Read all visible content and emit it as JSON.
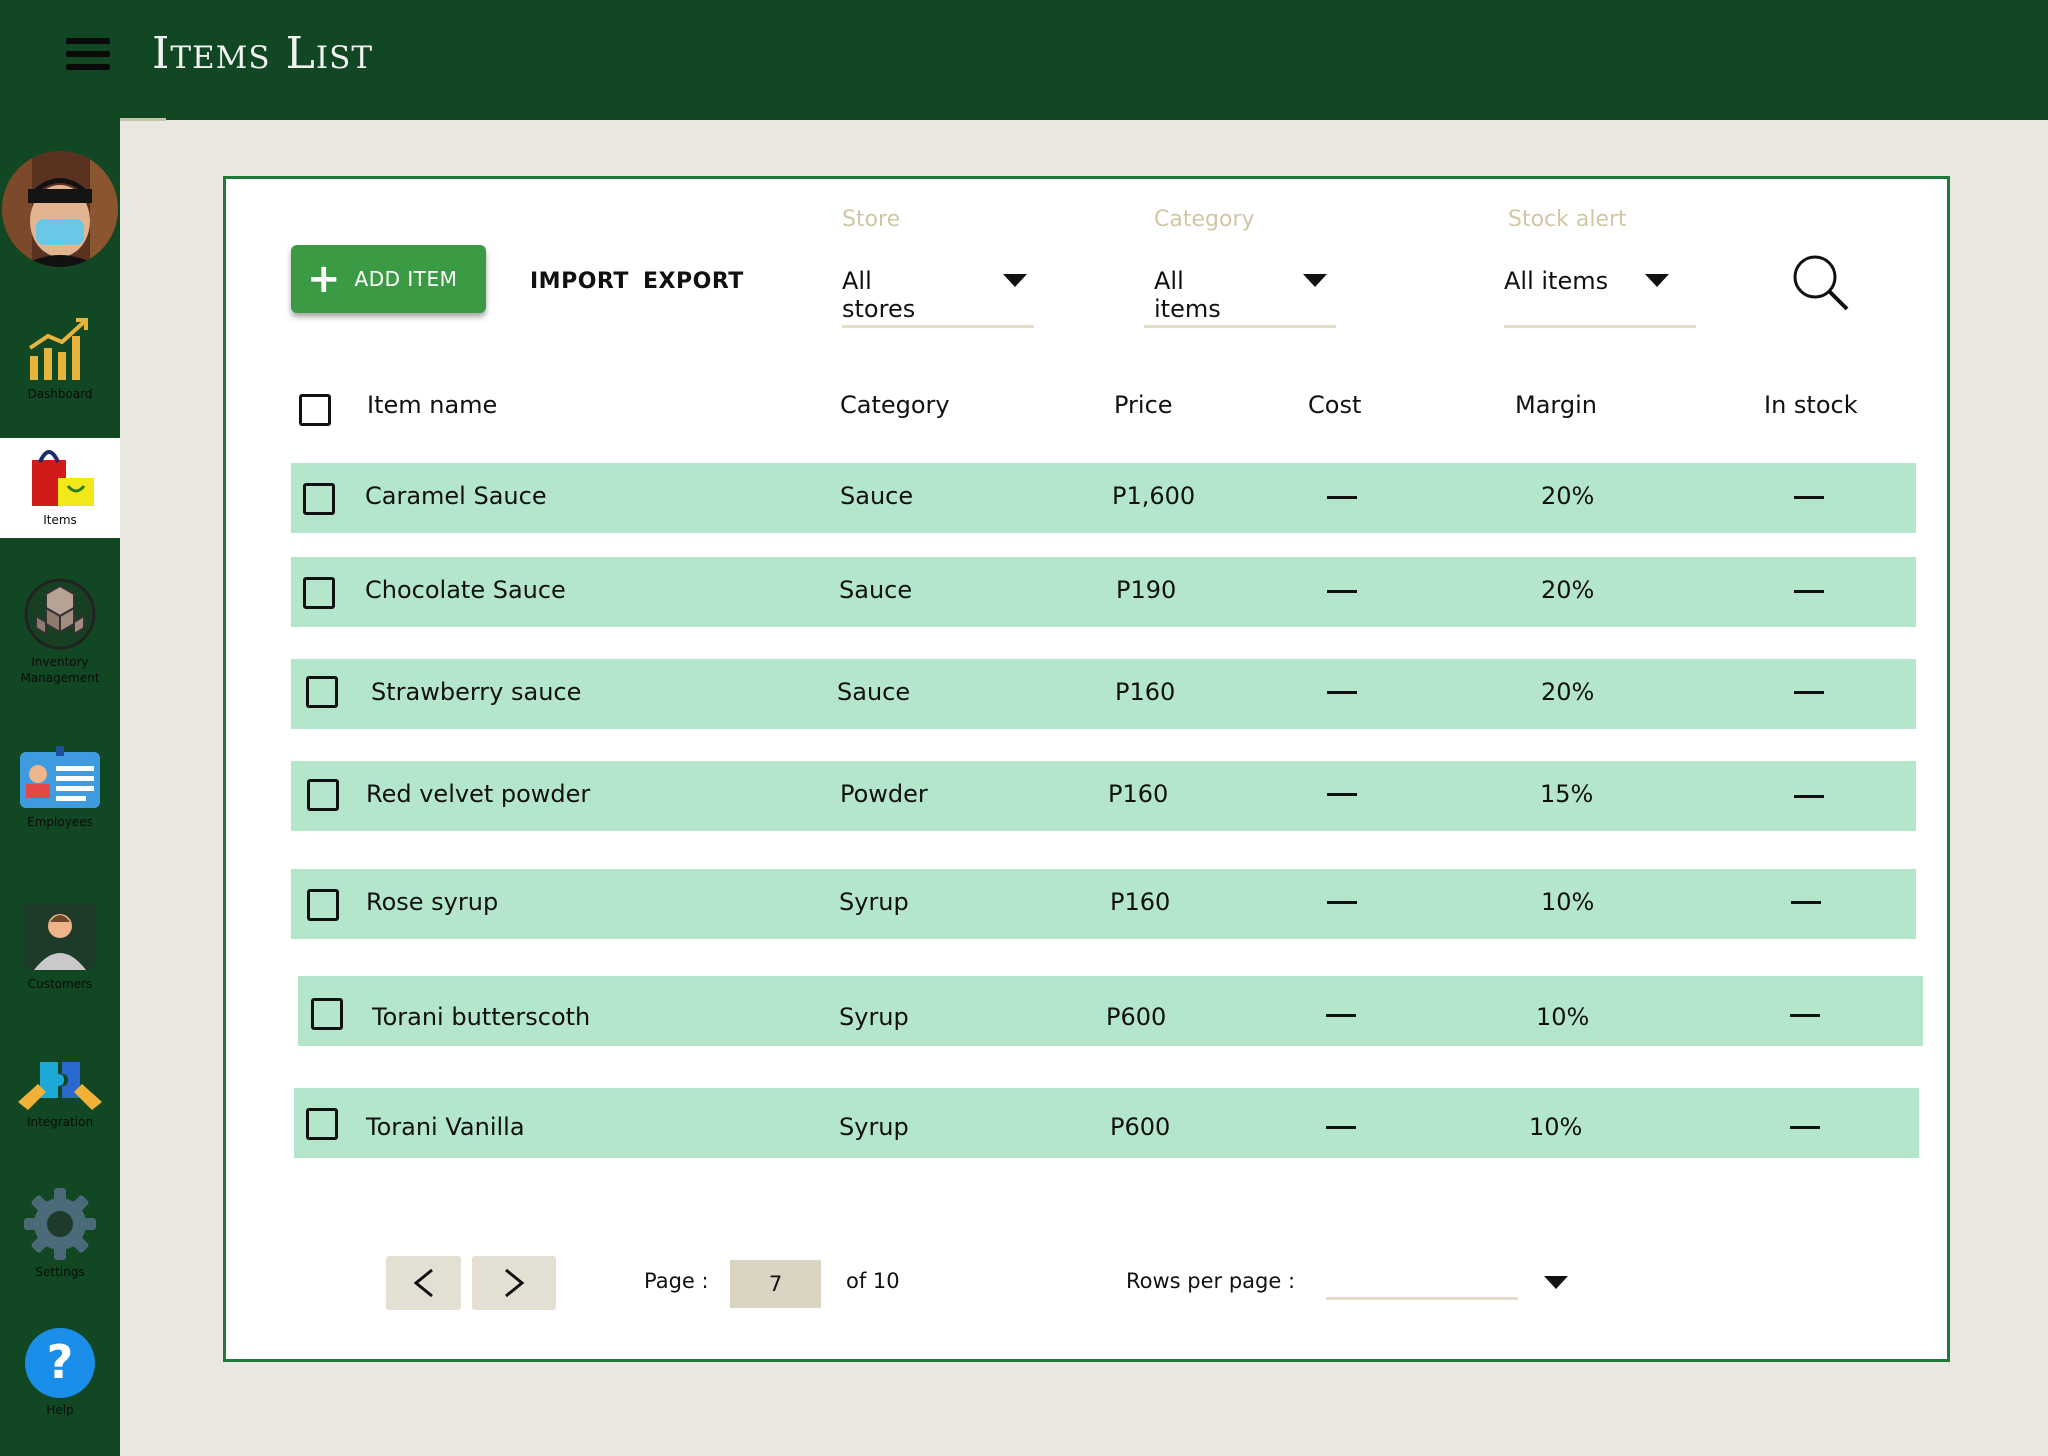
{
  "header": {
    "title": "Items List"
  },
  "sidebar": {
    "items": [
      {
        "label": "Dashboard"
      },
      {
        "label": "Items"
      },
      {
        "label": "Inventory Management"
      },
      {
        "label": "Employees"
      },
      {
        "label": "Customers"
      },
      {
        "label": "Integration"
      },
      {
        "label": "Settings"
      },
      {
        "label": "Help"
      }
    ],
    "active_color": "#ffffff"
  },
  "toolbar": {
    "add_label": "ADD ITEM",
    "import_label": "IMPORT",
    "export_label": "EXPORT"
  },
  "filters": {
    "store": {
      "label": "Store",
      "value": "All stores"
    },
    "category": {
      "label": "Category",
      "value": "All items"
    },
    "stock_alert": {
      "label": "Stock alert",
      "value": "All items"
    }
  },
  "table": {
    "columns": [
      "Item name",
      "Category",
      "Price",
      "Cost",
      "Margin",
      "In stock"
    ],
    "rows": [
      {
        "name": "Caramel Sauce",
        "category": "Sauce",
        "price": "P1,600",
        "cost": "—",
        "margin": "20%",
        "in_stock": "—"
      },
      {
        "name": "Chocolate Sauce",
        "category": "Sauce",
        "price": "P190",
        "cost": "—",
        "margin": "20%",
        "in_stock": "—"
      },
      {
        "name": "Strawberry sauce",
        "category": "Sauce",
        "price": "P160",
        "cost": "—",
        "margin": "20%",
        "in_stock": "—"
      },
      {
        "name": "Red velvet powder",
        "category": "Powder",
        "price": "P160",
        "cost": "—",
        "margin": "15%",
        "in_stock": "—"
      },
      {
        "name": "Rose syrup",
        "category": "Syrup",
        "price": "P160",
        "cost": "—",
        "margin": "10%",
        "in_stock": "—"
      },
      {
        "name": "Torani butterscoth",
        "category": "Syrup",
        "price": "P600",
        "cost": "—",
        "margin": "10%",
        "in_stock": "—"
      },
      {
        "name": "Torani Vanilla",
        "category": "Syrup",
        "price": "P600",
        "cost": "—",
        "margin": "10%",
        "in_stock": "—"
      }
    ]
  },
  "pagination": {
    "page_label": "Page :",
    "page": "7",
    "of_label": "of 10",
    "rows_per_page_label": "Rows per page :",
    "rows_per_page_value": ""
  },
  "colors": {
    "topbar": "#114723",
    "add_button": "#3b9b44",
    "row_bg": "#b4e6cc",
    "panel_border": "#1f7a3a"
  }
}
